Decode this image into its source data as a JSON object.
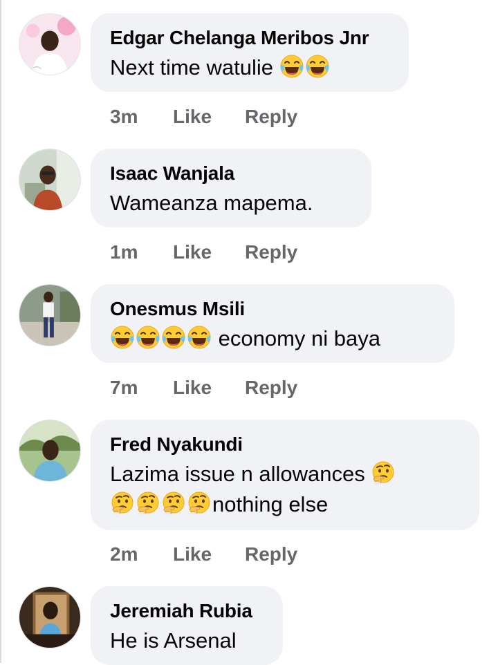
{
  "comments": [
    {
      "author": "Edgar Chelanga Meribos Jnr",
      "text_before": "Next time watulie ",
      "emojis_before": [],
      "emojis_after": [
        "laughing-crying-icon",
        "laughing-crying-icon"
      ],
      "text_line2": "",
      "time": "3m",
      "like": "Like",
      "reply": "Reply"
    },
    {
      "author": "Isaac Wanjala",
      "text_before": "Wameanza mapema.",
      "time": "1m",
      "like": "Like",
      "reply": "Reply"
    },
    {
      "author": "Onesmus Msili",
      "text_before": " economy ni baya",
      "emojis_before": [
        "laughing-crying-icon",
        "laughing-crying-icon",
        "laughing-crying-icon",
        "laughing-crying-icon"
      ],
      "time": "7m",
      "like": "Like",
      "reply": "Reply"
    },
    {
      "author": "Fred Nyakundi",
      "text_before": "Lazima issue n allowances ",
      "emojis_after": [
        "thinking-face-icon"
      ],
      "emojis_line2": [
        "thinking-face-icon",
        "thinking-face-icon",
        "thinking-face-icon",
        "thinking-face-icon"
      ],
      "text_line2": "nothing else",
      "time": "2m",
      "like": "Like",
      "reply": "Reply"
    },
    {
      "author": "Jeremiah Rubia",
      "text_before": "He is Arsenal"
    }
  ],
  "colors": {
    "bubble": "#f0f2f5",
    "meta": "#65676b",
    "text": "#050505"
  }
}
